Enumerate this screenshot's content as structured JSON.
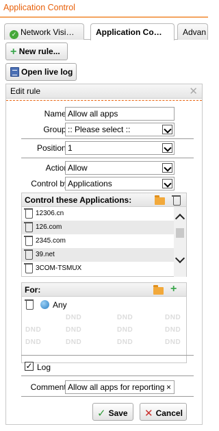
{
  "app": {
    "title": "Application Control"
  },
  "tabs": [
    {
      "label": "Network Visi…",
      "icon": "check-circle-icon"
    },
    {
      "label": "Application Co…"
    },
    {
      "label": "Advan"
    }
  ],
  "toolbar": {
    "new_rule_label": "New rule...",
    "open_live_log_label": "Open live log"
  },
  "edit_rule": {
    "title": "Edit rule",
    "name_label": "Name:",
    "name_value": "Allow all apps",
    "group_label": "Group:",
    "group_value": ":: Please select ::",
    "position_label": "Position:",
    "position_value": "1",
    "action_label": "Action",
    "action_value": "Allow",
    "control_by_label": "Control by",
    "control_by_value": "Applications",
    "applications_header": "Control these Applications:",
    "applications": [
      "12306.cn",
      "126.com",
      "2345.com",
      "39.net",
      "3COM-TSMUX"
    ],
    "for_header": "For:",
    "for_items": [
      "Any"
    ],
    "dnd_text": "DND",
    "log_label": "Log",
    "log_checked": true,
    "comment_label": "Comment:",
    "comment_value": "Allow all apps for reporting",
    "save_label": "Save",
    "cancel_label": "Cancel"
  },
  "colors": {
    "accent": "#e8600a",
    "add_green": "#3aa64c",
    "cancel_red": "#c9302c",
    "folder": "#f2a93b"
  }
}
